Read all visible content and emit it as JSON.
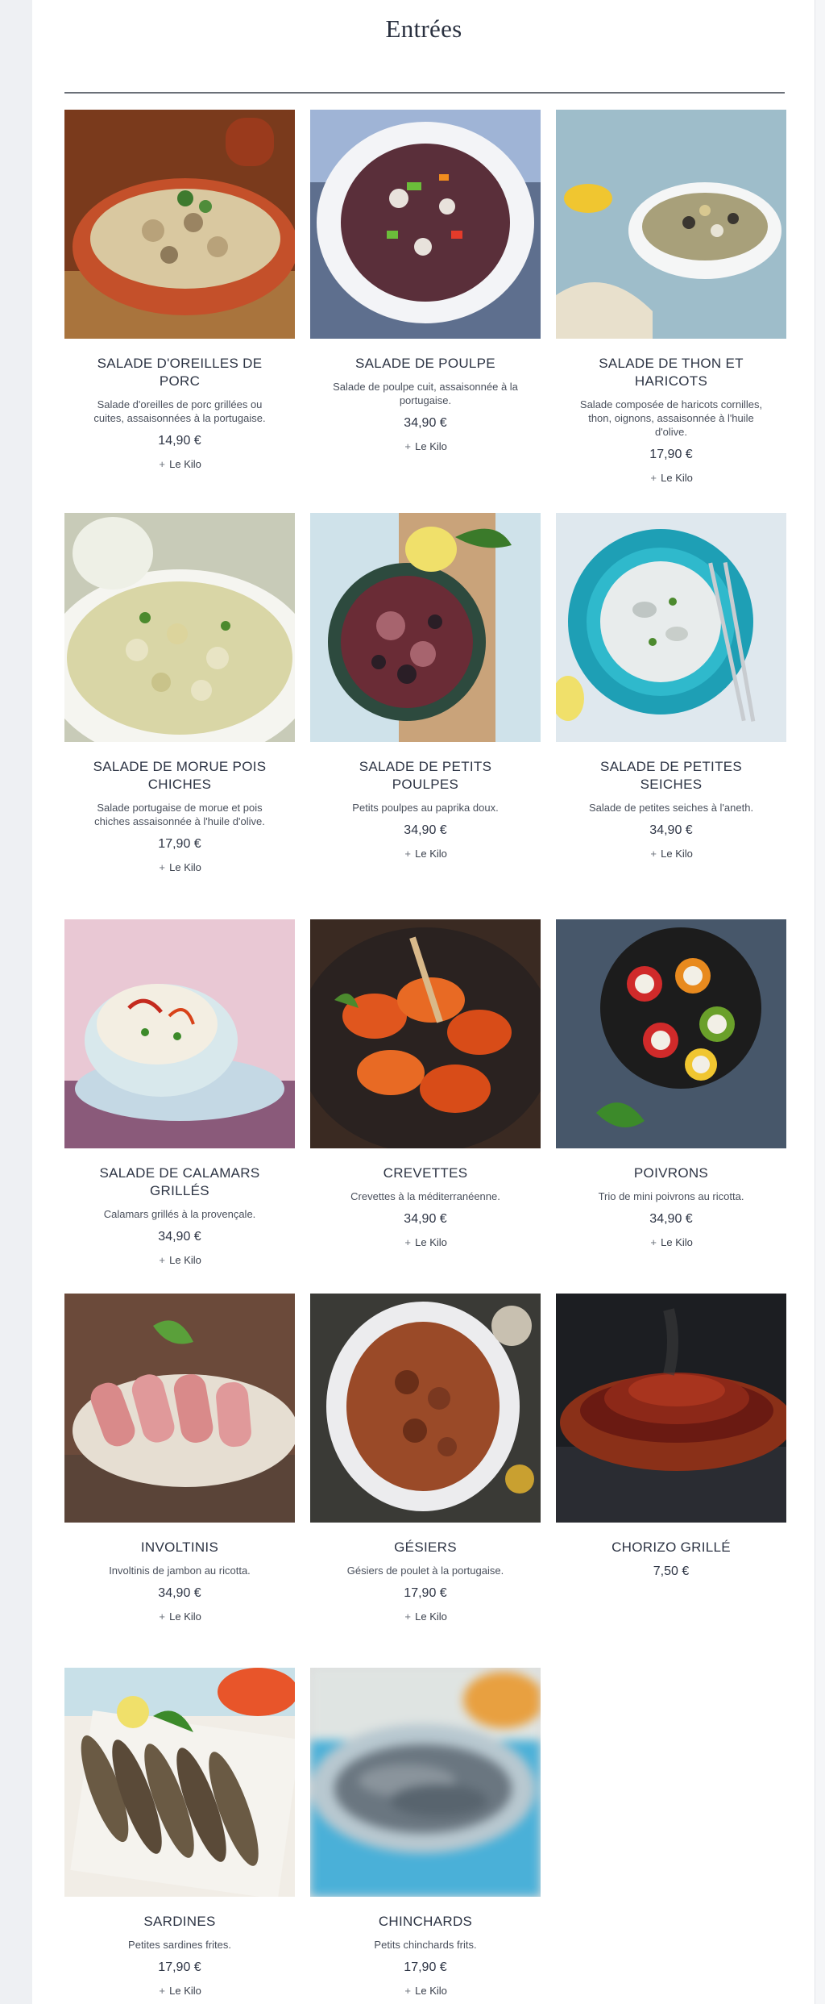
{
  "section": {
    "title": "Entrées"
  },
  "items": [
    {
      "name": "SALADE D'OREILLES DE PORC",
      "desc": "Salade d'oreilles de porc grillées ou cuites, assaisonnées à la portugaise.",
      "price": "14,90 €",
      "unit": "Le Kilo",
      "image_icon": "pork-ear-salad-photo"
    },
    {
      "name": "SALADE DE POULPE",
      "desc": "Salade de poulpe cuit, assaisonnée à la portugaise.",
      "price": "34,90 €",
      "unit": "Le Kilo",
      "image_icon": "octopus-salad-photo"
    },
    {
      "name": "SALADE DE THON ET HARICOTS",
      "desc": "Salade composée de haricots cornilles, thon, oignons, assaisonnée à l'huile d'olive.",
      "price": "17,90 €",
      "unit": "Le Kilo",
      "image_icon": "tuna-bean-salad-photo"
    },
    {
      "name": "SALADE DE MORUE POIS CHICHES",
      "desc": "Salade portugaise de morue et pois chiches assaisonnée à l'huile d'olive.",
      "price": "17,90 €",
      "unit": "Le Kilo",
      "image_icon": "cod-chickpea-salad-photo"
    },
    {
      "name": "SALADE DE PETITS POULPES",
      "desc": "Petits poulpes au paprika doux.",
      "price": "34,90 €",
      "unit": "Le Kilo",
      "image_icon": "baby-octopus-photo"
    },
    {
      "name": "SALADE DE PETITES SEICHES",
      "desc": "Salade de petites seiches à l'aneth.",
      "price": "34,90 €",
      "unit": "Le Kilo",
      "image_icon": "cuttlefish-salad-photo"
    },
    {
      "name": "SALADE DE CALAMARS GRILLÉS",
      "desc": "Calamars grillés à la provençale.",
      "price": "34,90 €",
      "unit": "Le Kilo",
      "image_icon": "grilled-squid-salad-photo"
    },
    {
      "name": "CREVETTES",
      "desc": "Crevettes à la méditerranéenne.",
      "price": "34,90 €",
      "unit": "Le Kilo",
      "image_icon": "shrimp-photo"
    },
    {
      "name": "POIVRONS",
      "desc": "Trio de mini poivrons au ricotta.",
      "price": "34,90 €",
      "unit": "Le Kilo",
      "image_icon": "stuffed-peppers-photo"
    },
    {
      "name": "INVOLTINIS",
      "desc": "Involtinis de jambon au ricotta.",
      "price": "34,90 €",
      "unit": "Le Kilo",
      "image_icon": "ham-rolls-photo"
    },
    {
      "name": "GÉSIERS",
      "desc": "Gésiers de poulet à la portugaise.",
      "price": "17,90 €",
      "unit": "Le Kilo",
      "image_icon": "gizzards-photo"
    },
    {
      "name": "CHORIZO GRILLÉ",
      "desc": "",
      "price": "7,50 €",
      "unit": "",
      "image_icon": "grilled-chorizo-photo"
    },
    {
      "name": "SARDINES",
      "desc": "Petites sardines frites.",
      "price": "17,90 €",
      "unit": "Le Kilo",
      "image_icon": "sardines-photo"
    },
    {
      "name": "CHINCHARDS",
      "desc": "Petits chinchards frits.",
      "price": "17,90 €",
      "unit": "Le Kilo",
      "image_icon": "horse-mackerel-photo"
    }
  ],
  "colors": {
    "text": "#2d3444",
    "background": "#ffffff",
    "page_gutter": "#eef0f3"
  }
}
